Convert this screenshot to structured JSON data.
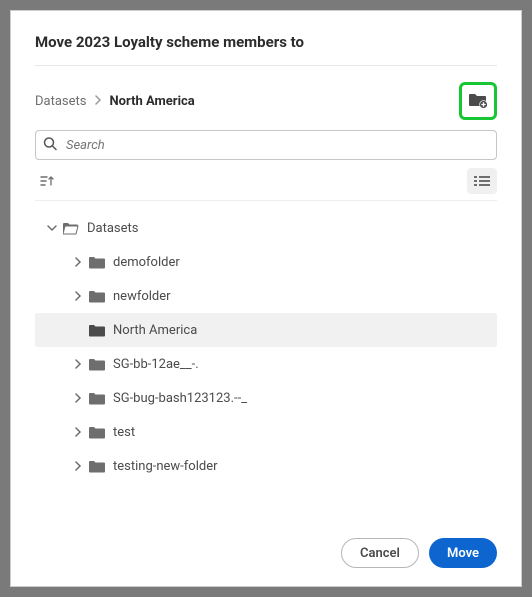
{
  "dialog": {
    "title": "Move 2023 Loyalty scheme members to"
  },
  "breadcrumb": {
    "root": "Datasets",
    "current": "North America"
  },
  "search": {
    "placeholder": "Search"
  },
  "tree": {
    "root": {
      "label": "Datasets",
      "expanded": true
    },
    "items": [
      {
        "label": "demofolder",
        "expandable": true,
        "selected": false
      },
      {
        "label": "newfolder",
        "expandable": true,
        "selected": false
      },
      {
        "label": "North America",
        "expandable": false,
        "selected": true
      },
      {
        "label": "SG-bb-12ae__-.",
        "expandable": true,
        "selected": false
      },
      {
        "label": "SG-bug-bash123123.--_",
        "expandable": true,
        "selected": false
      },
      {
        "label": "test",
        "expandable": true,
        "selected": false
      },
      {
        "label": "testing-new-folder",
        "expandable": true,
        "selected": false
      }
    ]
  },
  "footer": {
    "cancel": "Cancel",
    "move": "Move"
  }
}
